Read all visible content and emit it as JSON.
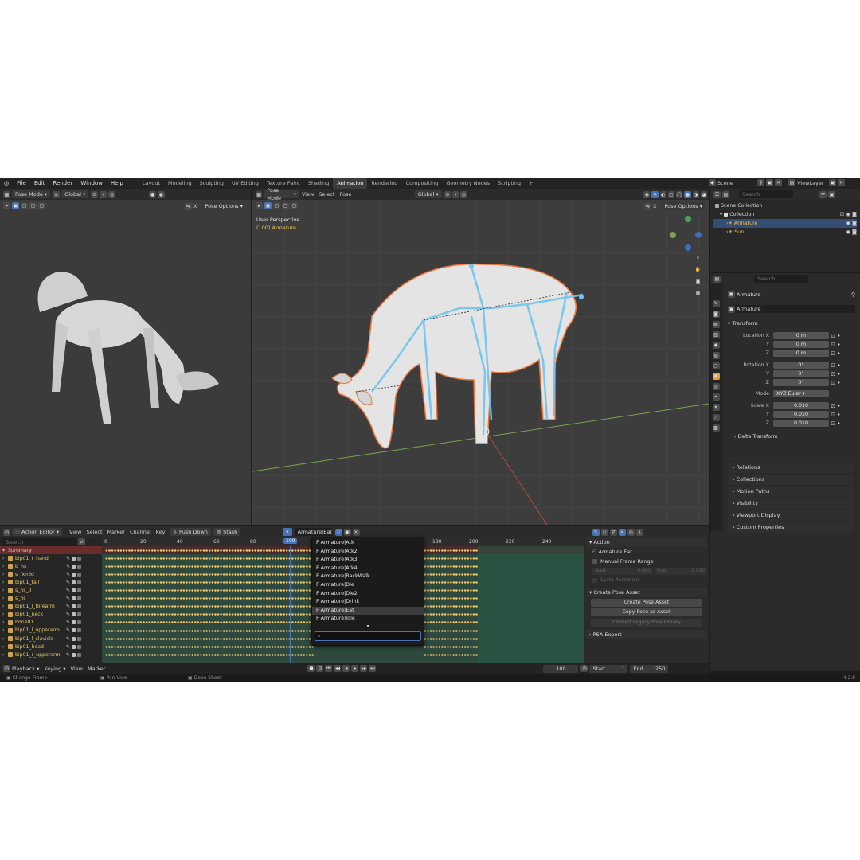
{
  "topbar": {
    "menus": [
      "File",
      "Edit",
      "Render",
      "Window",
      "Help"
    ],
    "workspaces": [
      "Layout",
      "Modeling",
      "Sculpting",
      "UV Editing",
      "Texture Paint",
      "Shading",
      "Animation",
      "Rendering",
      "Compositing",
      "Geometry Nodes",
      "Scripting"
    ],
    "active_workspace": "Animation",
    "add_tab": "+",
    "scene": "Scene",
    "view_layer": "ViewLayer"
  },
  "left_viewport": {
    "mode": "Pose Mode",
    "orientation": "Global",
    "pose_options": "Pose Options",
    "x_label": "X"
  },
  "main_viewport": {
    "mode": "Pose Mode",
    "menus": [
      "View",
      "Select",
      "Pose"
    ],
    "orientation": "Global",
    "pose_options": "Pose Options",
    "x_label": "X",
    "perspective": "User Perspective",
    "object_info": "(100) Armature"
  },
  "outliner": {
    "search_placeholder": "Search",
    "scene_collection": "Scene Collection",
    "collection": "Collection",
    "items": [
      "Armature",
      "Sun"
    ]
  },
  "properties": {
    "search_placeholder": "Search",
    "object_name": "Armature",
    "object_field": "Armature",
    "transform_title": "Transform",
    "location_label": "Location X",
    "rotation_label": "Rotation X",
    "scale_label": "Scale X",
    "y": "Y",
    "z": "Z",
    "location": [
      "0 m",
      "0 m",
      "0 m"
    ],
    "rotation": [
      "0°",
      "0°",
      "0°"
    ],
    "mode_label": "Mode",
    "mode_value": "XYZ Euler",
    "scale": [
      "0.010",
      "0.010",
      "0.010"
    ],
    "sections": [
      "Delta Transform",
      "Relations",
      "Collections",
      "Motion Paths",
      "Visibility",
      "Viewport Display",
      "Custom Properties"
    ]
  },
  "dopesheet": {
    "editor": "Action Editor",
    "menus": [
      "View",
      "Select",
      "Marker",
      "Channel",
      "Key"
    ],
    "push_down": "Push Down",
    "stash": "Stash",
    "action_name": "Armature|Eat",
    "search_placeholder": "Search",
    "ruler": [
      "0",
      "20",
      "40",
      "60",
      "80",
      "100",
      "180",
      "200",
      "220",
      "240"
    ],
    "current_frame": "100",
    "summary": "Summary",
    "channels": [
      "bip01_r_hand",
      "b_hs",
      "s_fxmid",
      "bip01_tail",
      "s_hs_0",
      "s_hs",
      "bip01_l_forearm",
      "bip01_neck",
      "bone01",
      "bip01_l_upperarm",
      "bip01_l_clavicle",
      "bip01_head",
      "bip01_r_upperarm"
    ],
    "actions": [
      "F Armature|Atk",
      "F Armature|Atk2",
      "F Armature|Atk3",
      "F Armature|Atk4",
      "F Armature|BackWalk",
      "F Armature|Die",
      "F Armature|Die2",
      "F Armature|Drink",
      "F Armature|Eat",
      "F Armature|Idle"
    ],
    "selected_action": "F Armature|Eat"
  },
  "action_panel": {
    "action_title": "Action",
    "action_name": "Armature|Eat",
    "manual_frame_range": "Manual Frame Range",
    "start_label": "Start",
    "start_value": "0.000",
    "end_label": "End",
    "end_value": "0.000",
    "cyclic": "Cyclic Animation",
    "create_pose_title": "Create Pose Asset",
    "create_pose_btn": "Create Pose Asset",
    "copy_pose_btn": "Copy Pose as Asset",
    "convert_btn": "Convert Legacy Pose Library",
    "psa_export": "PSA Export"
  },
  "timeline": {
    "menus": [
      "Playback",
      "Keying",
      "View",
      "Marker"
    ],
    "frame": "100",
    "start_label": "Start",
    "start_value": "1",
    "end_label": "End",
    "end_value": "250"
  },
  "statusbar": {
    "items": [
      "Change Frame",
      "Pan View",
      "Dope Sheet"
    ],
    "version": "4.2.8"
  },
  "colors": {
    "accent": "#4772b3",
    "keyframe": "#e9c36a",
    "selection_outline": "#e8743b",
    "bones": "#6ec3f0"
  }
}
